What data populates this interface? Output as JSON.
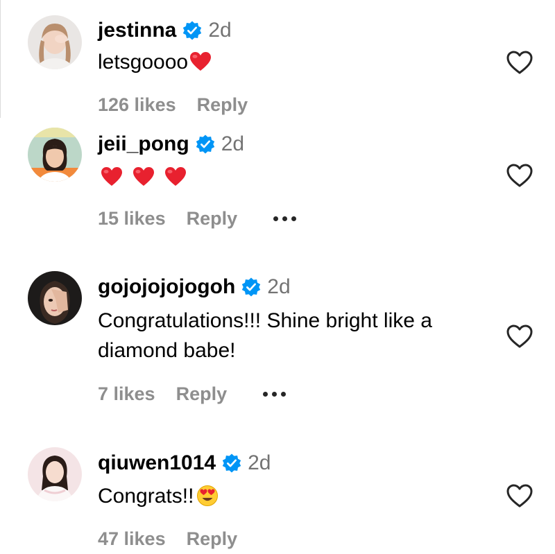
{
  "comments": [
    {
      "username": "jestinna",
      "time": "2d",
      "text": "letsgoooo",
      "likes": "126 likes",
      "reply": "Reply",
      "emoji": [
        "red-heart-icon"
      ],
      "has_more": false
    },
    {
      "username": "jeii_pong",
      "time": "2d",
      "text": "",
      "likes": "15 likes",
      "reply": "Reply",
      "emoji": [
        "red-heart-icon",
        "red-heart-icon",
        "red-heart-icon"
      ],
      "has_more": true
    },
    {
      "username": "gojojojojogoh",
      "time": "2d",
      "text": "Congratulations!!! Shine bright like a diamond babe!",
      "likes": "7 likes",
      "reply": "Reply",
      "emoji": [],
      "has_more": true
    },
    {
      "username": "qiuwen1014",
      "time": "2d",
      "text": "Congrats!!",
      "likes": "47 likes",
      "reply": "Reply",
      "emoji": [
        "heart-eyes-emoji-icon"
      ],
      "has_more": false
    }
  ],
  "colors": {
    "verified_blue": "#0095f6",
    "muted_text": "#737373",
    "meta_text": "#8e8e8e",
    "heart_red": "#e8212f"
  }
}
